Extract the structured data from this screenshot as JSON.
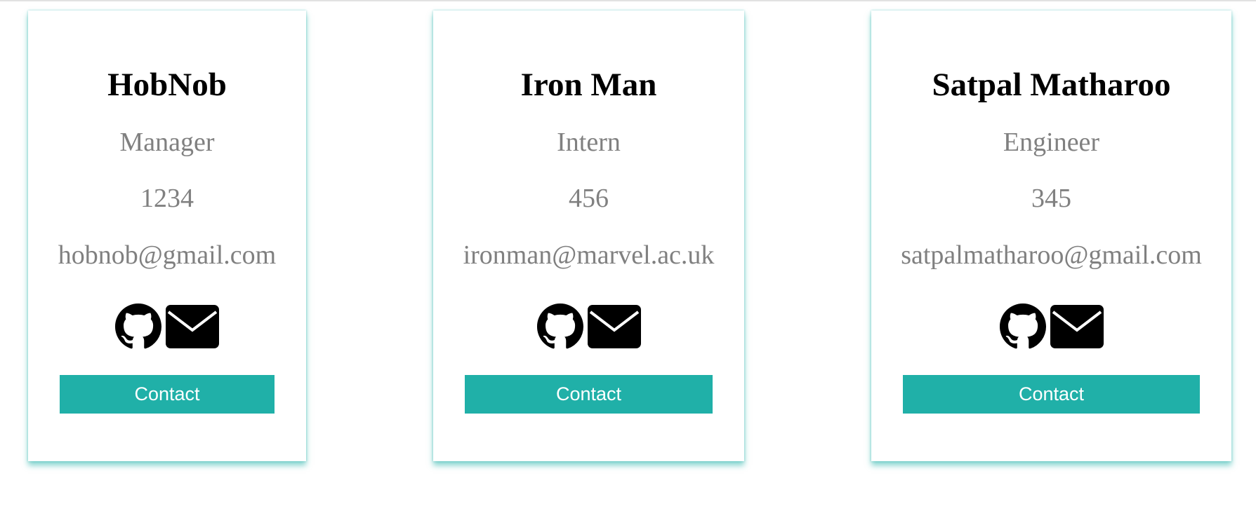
{
  "employees": [
    {
      "name": "HobNob",
      "role": "Manager",
      "id": "1234",
      "email": "hobnob@gmail.com",
      "icons": [
        "github-icon",
        "mail-icon"
      ],
      "contact_label": "Contact"
    },
    {
      "name": "Iron Man",
      "role": "Intern",
      "id": "456",
      "email": "ironman@marvel.ac.uk",
      "icons": [
        "github-icon",
        "mail-icon"
      ],
      "contact_label": "Contact"
    },
    {
      "name": "Satpal Matharoo",
      "role": "Engineer",
      "id": "345",
      "email": "satpalmatharoo@gmail.com",
      "icons": [
        "github-icon",
        "mail-icon"
      ],
      "contact_label": "Contact"
    }
  ],
  "colors": {
    "accent": "#20b0a8",
    "muted_text": "#808080",
    "name_text": "#000000",
    "background": "#ffffff"
  }
}
